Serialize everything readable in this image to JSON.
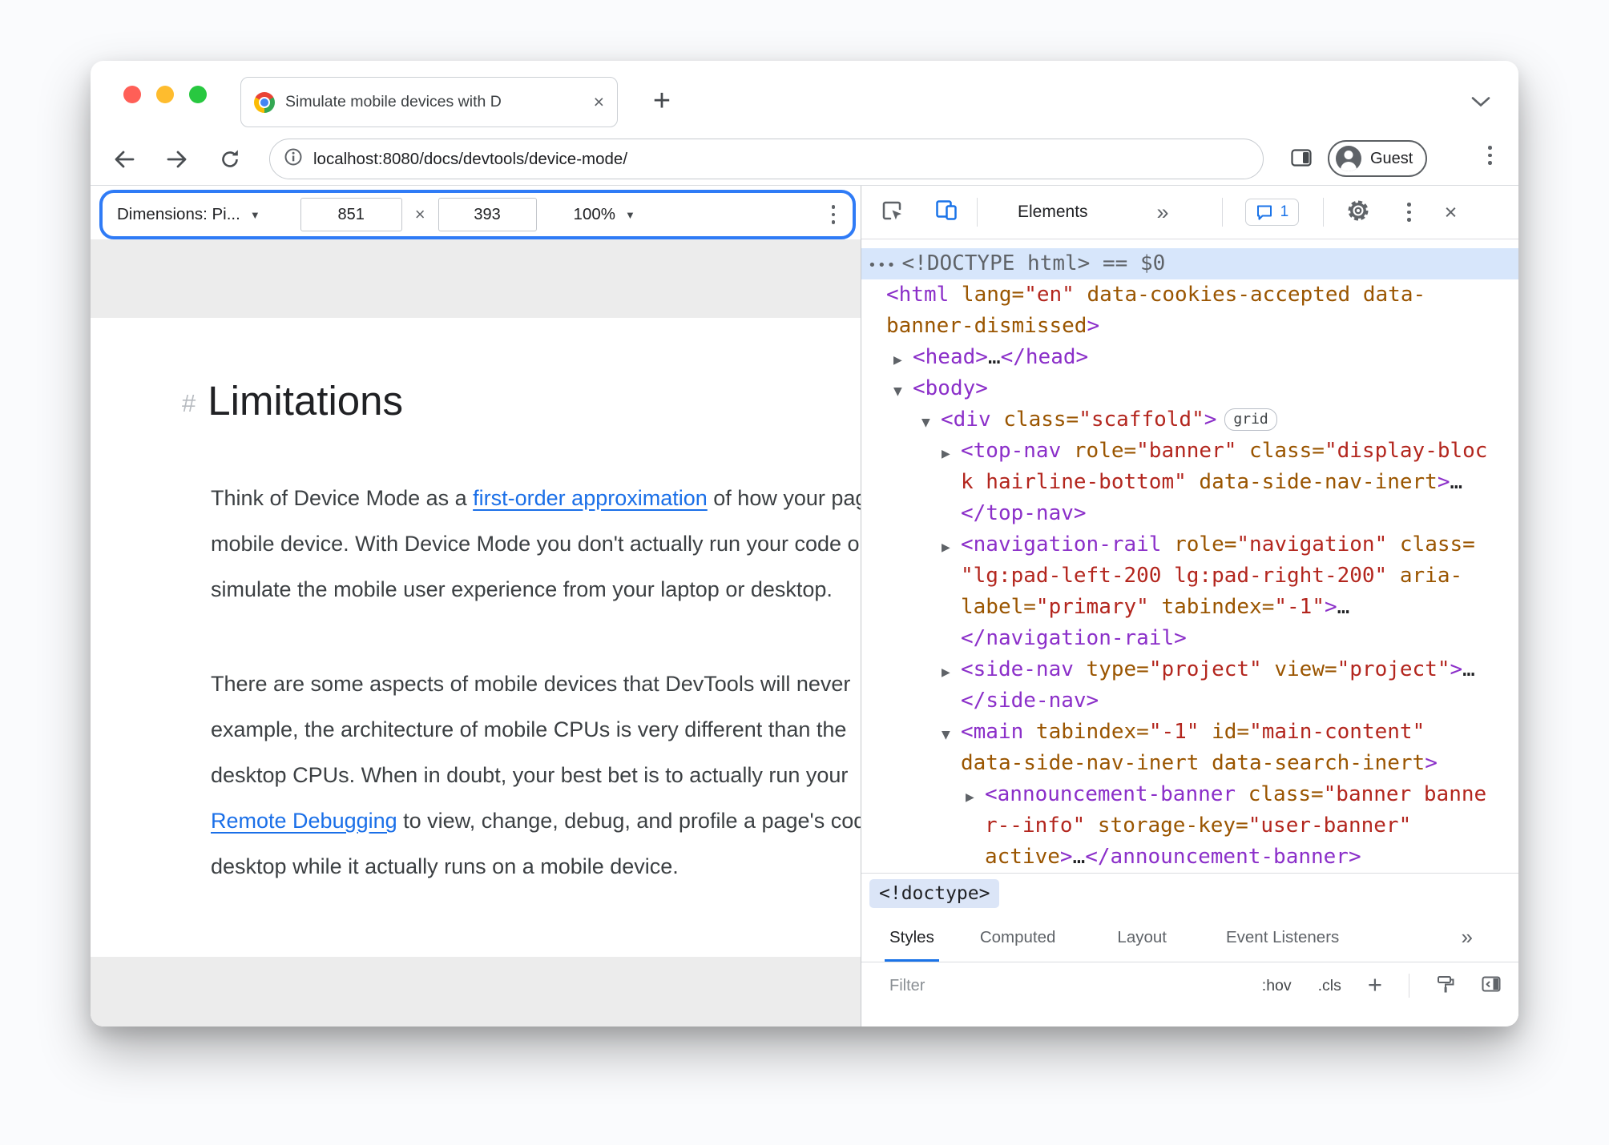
{
  "colors": {
    "accent_blue": "#1a73e8",
    "highlight_outline": "#2f7bf6",
    "token_tag": "#8B2FC9",
    "token_attr": "#9A5500",
    "token_value": "#B3261E",
    "selected_row": "#d7e6fb",
    "traffic_red": "#ff5f57",
    "traffic_yellow": "#febc2e",
    "traffic_green": "#28c840"
  },
  "icons": {
    "dropdown_arrow": "▼",
    "collapsed_arrow": "▶",
    "expanded_arrow": "▼",
    "close": "×",
    "more_chevrons": "»",
    "plus": "+"
  },
  "browser": {
    "tab_title": "Simulate mobile devices with D",
    "url": "localhost:8080/docs/devtools/device-mode/",
    "guest_label": "Guest"
  },
  "device_toolbar": {
    "dimensions_label": "Dimensions: Pi...",
    "width_value": "851",
    "times": "×",
    "height_value": "393",
    "zoom_value": "100%"
  },
  "page": {
    "heading_anchor": "#",
    "heading": "Limitations",
    "paragraphs": [
      {
        "lines": [
          [
            [
              "t",
              "Think of Device Mode as a "
            ],
            [
              "l",
              "first-order approximation"
            ],
            [
              "t",
              " of how your page looks"
            ]
          ],
          [
            [
              "t",
              "mobile device. With Device Mode you don't actually run your code on a"
            ]
          ],
          [
            [
              "t",
              "simulate the mobile user experience from your laptop or desktop."
            ]
          ]
        ]
      },
      {
        "lines": [
          [
            [
              "t",
              "There are some aspects of mobile devices that DevTools will never"
            ]
          ],
          [
            [
              "t",
              "example, the architecture of mobile CPUs is very different than the"
            ]
          ],
          [
            [
              "t",
              "desktop CPUs. When in doubt, your best bet is to actually run your"
            ]
          ],
          [
            [
              "l",
              "Remote Debugging"
            ],
            [
              "t",
              " to view, change, debug, and profile a page's code"
            ]
          ],
          [
            [
              "t",
              "desktop while it actually runs on a mobile device."
            ]
          ]
        ]
      }
    ]
  },
  "devtools": {
    "toolbar": {
      "elements_tab": "Elements",
      "more_tabs": "»",
      "console_count": "1"
    },
    "dom": {
      "lines": [
        {
          "pad": 8,
          "sel": true,
          "parts": [
            [
              "dots",
              "•••"
            ],
            [
              "d",
              "<!DOCTYPE html>"
            ],
            [
              "m",
              " == $0"
            ]
          ]
        },
        {
          "pad": 31,
          "parts": [
            [
              "b",
              "<"
            ],
            [
              "t",
              "html"
            ],
            [
              "a",
              " lang="
            ],
            [
              "v",
              "\"en\""
            ],
            [
              "a",
              " data-cookies-accepted data-"
            ]
          ]
        },
        {
          "pad": 31,
          "parts": [
            [
              "a",
              "banner-dismissed"
            ],
            [
              "b",
              ">"
            ]
          ]
        },
        {
          "pad": 40,
          "arrow": "r",
          "parts": [
            [
              "b",
              "<"
            ],
            [
              "t",
              "head"
            ],
            [
              "b",
              ">"
            ],
            [
              "e",
              "…"
            ],
            [
              "b",
              "</"
            ],
            [
              "t",
              "head"
            ],
            [
              "b",
              ">"
            ]
          ]
        },
        {
          "pad": 40,
          "arrow": "d",
          "parts": [
            [
              "b",
              "<"
            ],
            [
              "t",
              "body"
            ],
            [
              "b",
              ">"
            ]
          ]
        },
        {
          "pad": 75,
          "arrow": "d",
          "badge": "grid",
          "parts": [
            [
              "b",
              "<"
            ],
            [
              "t",
              "div"
            ],
            [
              "a",
              " class="
            ],
            [
              "v",
              "\"scaffold\""
            ],
            [
              "b",
              ">"
            ]
          ]
        },
        {
          "pad": 100,
          "arrow": "r",
          "parts": [
            [
              "b",
              "<"
            ],
            [
              "t",
              "top-nav"
            ],
            [
              "a",
              " role="
            ],
            [
              "v",
              "\"banner\""
            ],
            [
              "a",
              " class="
            ],
            [
              "v",
              "\"display-bloc"
            ]
          ]
        },
        {
          "pad": 124,
          "parts": [
            [
              "v",
              "k hairline-bottom\""
            ],
            [
              "a",
              " data-side-nav-inert"
            ],
            [
              "b",
              ">"
            ],
            [
              "e",
              "…"
            ]
          ]
        },
        {
          "pad": 124,
          "parts": [
            [
              "b",
              "</"
            ],
            [
              "t",
              "top-nav"
            ],
            [
              "b",
              ">"
            ]
          ]
        },
        {
          "pad": 100,
          "arrow": "r",
          "parts": [
            [
              "b",
              "<"
            ],
            [
              "t",
              "navigation-rail"
            ],
            [
              "a",
              " role="
            ],
            [
              "v",
              "\"navigation\""
            ],
            [
              "a",
              " class="
            ]
          ]
        },
        {
          "pad": 124,
          "parts": [
            [
              "v",
              "\"lg:pad-left-200 lg:pad-right-200\""
            ],
            [
              "a",
              " aria-"
            ]
          ]
        },
        {
          "pad": 124,
          "parts": [
            [
              "a",
              "label="
            ],
            [
              "v",
              "\"primary\""
            ],
            [
              "a",
              " tabindex="
            ],
            [
              "v",
              "\"-1\""
            ],
            [
              "b",
              ">"
            ],
            [
              "e",
              "…"
            ]
          ]
        },
        {
          "pad": 124,
          "parts": [
            [
              "b",
              "</"
            ],
            [
              "t",
              "navigation-rail"
            ],
            [
              "b",
              ">"
            ]
          ]
        },
        {
          "pad": 100,
          "arrow": "r",
          "parts": [
            [
              "b",
              "<"
            ],
            [
              "t",
              "side-nav"
            ],
            [
              "a",
              " type="
            ],
            [
              "v",
              "\"project\""
            ],
            [
              "a",
              " view="
            ],
            [
              "v",
              "\"project\""
            ],
            [
              "b",
              ">"
            ],
            [
              "e",
              "…"
            ]
          ]
        },
        {
          "pad": 124,
          "parts": [
            [
              "b",
              "</"
            ],
            [
              "t",
              "side-nav"
            ],
            [
              "b",
              ">"
            ]
          ]
        },
        {
          "pad": 100,
          "arrow": "d",
          "parts": [
            [
              "b",
              "<"
            ],
            [
              "t",
              "main"
            ],
            [
              "a",
              " tabindex="
            ],
            [
              "v",
              "\"-1\""
            ],
            [
              "a",
              " id="
            ],
            [
              "v",
              "\"main-content\""
            ]
          ]
        },
        {
          "pad": 124,
          "parts": [
            [
              "a",
              "data-side-nav-inert data-search-inert"
            ],
            [
              "b",
              ">"
            ]
          ]
        },
        {
          "pad": 130,
          "arrow": "r",
          "parts": [
            [
              "b",
              "<"
            ],
            [
              "t",
              "announcement-banner"
            ],
            [
              "a",
              " class="
            ],
            [
              "v",
              "\"banner banne"
            ]
          ]
        },
        {
          "pad": 154,
          "parts": [
            [
              "v",
              "r--info\""
            ],
            [
              "a",
              " storage-key="
            ],
            [
              "v",
              "\"user-banner\""
            ]
          ]
        },
        {
          "pad": 154,
          "parts": [
            [
              "a",
              "active"
            ],
            [
              "b",
              ">"
            ],
            [
              "e",
              "…"
            ],
            [
              "b",
              "</"
            ],
            [
              "t",
              "announcement-banner"
            ],
            [
              "b",
              ">"
            ]
          ]
        }
      ]
    },
    "breadcrumb": "<!doctype>",
    "panes": {
      "tabs": [
        "Styles",
        "Computed",
        "Layout",
        "Event Listeners"
      ],
      "more": "»",
      "filter_placeholder": "Filter",
      "hov": ":hov",
      "cls": ".cls",
      "plus": "+",
      "grid_badge": "grid"
    }
  }
}
